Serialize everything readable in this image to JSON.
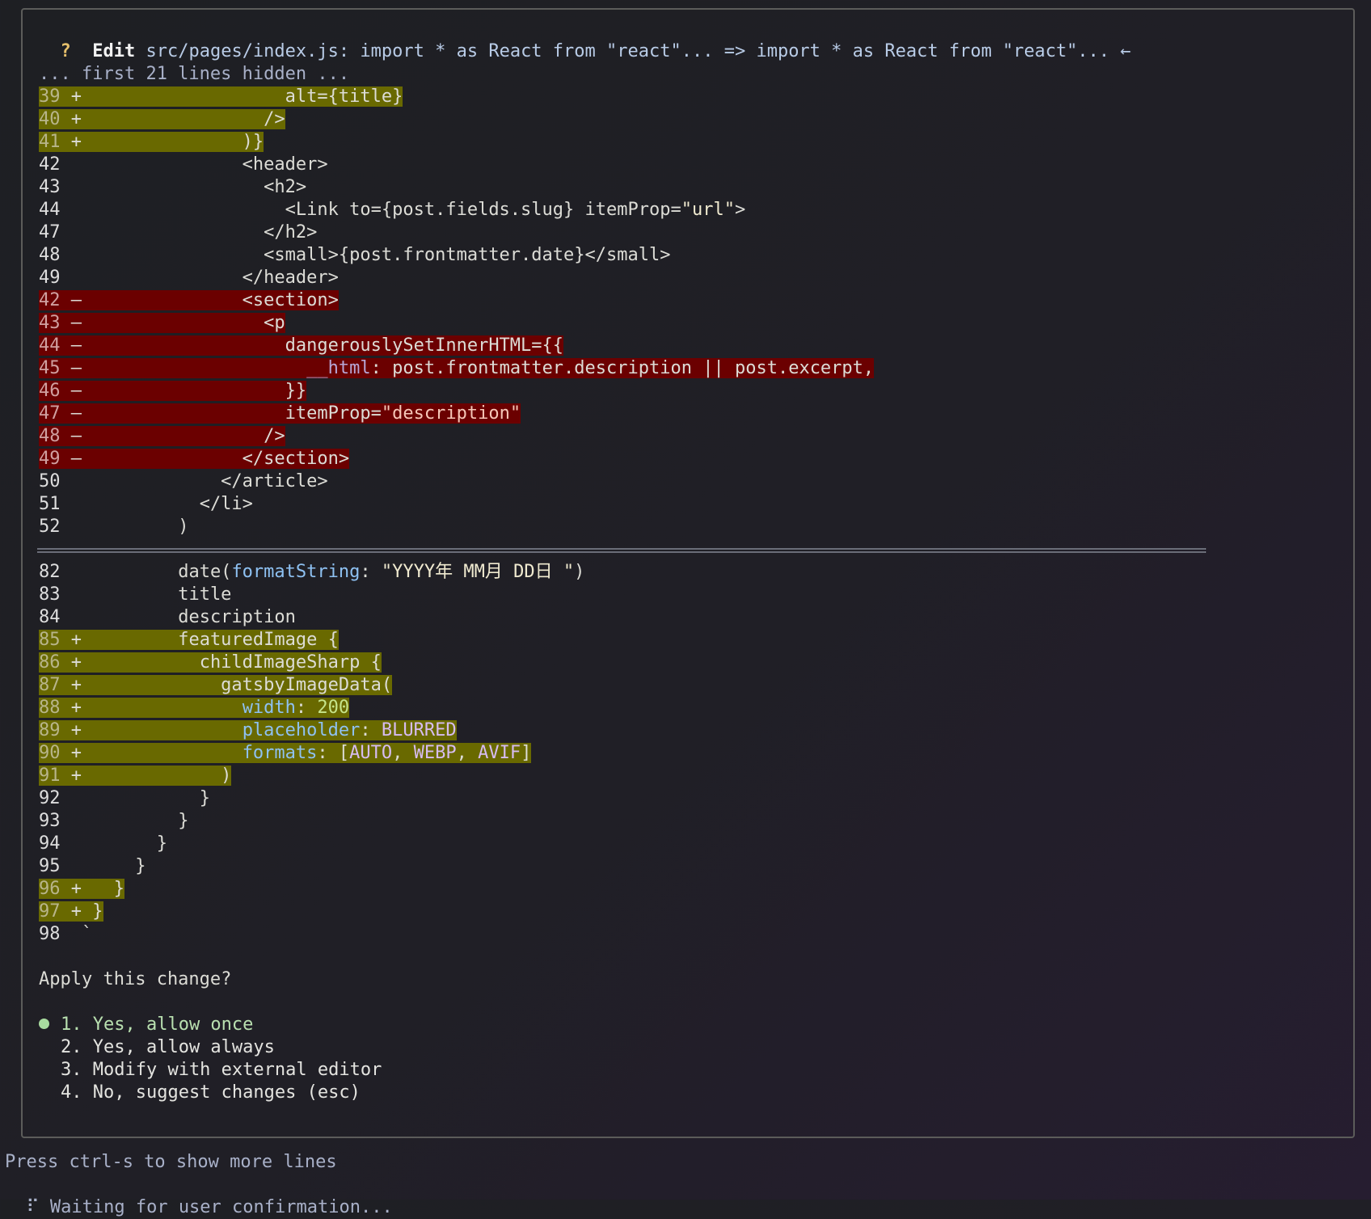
{
  "header": {
    "prompt_mark": "?",
    "action": "Edit",
    "description": "src/pages/index.js: import * as React from \"react\"... => import * as React from \"react\"... ←"
  },
  "hidden_notice": "... first 21 lines hidden ...",
  "hunk1": [
    {
      "num": "39",
      "sign": "+",
      "type": "add",
      "code": "                   alt={title}"
    },
    {
      "num": "40",
      "sign": "+",
      "type": "add",
      "code": "                 />"
    },
    {
      "num": "41",
      "sign": "+",
      "type": "add",
      "code": "               )}"
    },
    {
      "num": "42",
      "sign": " ",
      "type": "ctx",
      "code": "               <header>"
    },
    {
      "num": "43",
      "sign": " ",
      "type": "ctx",
      "code": "                 <h2>"
    },
    {
      "num": "44",
      "sign": " ",
      "type": "ctx",
      "code": "                   <Link to={post.fields.slug} itemProp=\"url\">"
    },
    {
      "num": "47",
      "sign": " ",
      "type": "ctx",
      "code": "                 </h2>"
    },
    {
      "num": "48",
      "sign": " ",
      "type": "ctx",
      "code": "                 <small>{post.frontmatter.date}</small>"
    },
    {
      "num": "49",
      "sign": " ",
      "type": "ctx",
      "code": "               </header>"
    },
    {
      "num": "42",
      "sign": "–",
      "type": "del",
      "code": "               <section>"
    },
    {
      "num": "43",
      "sign": "–",
      "type": "del",
      "code": "                 <p"
    },
    {
      "num": "44",
      "sign": "–",
      "type": "del",
      "code": "                   dangerouslySetInnerHTML={{"
    },
    {
      "num": "45",
      "sign": "–",
      "type": "del",
      "code": "                     __html: post.frontmatter.description || post.excerpt,"
    },
    {
      "num": "46",
      "sign": "–",
      "type": "del",
      "code": "                   }}"
    },
    {
      "num": "47",
      "sign": "–",
      "type": "del",
      "code": "                   itemProp=\"description\""
    },
    {
      "num": "48",
      "sign": "–",
      "type": "del",
      "code": "                 />"
    },
    {
      "num": "49",
      "sign": "–",
      "type": "del",
      "code": "               </section>"
    },
    {
      "num": "50",
      "sign": " ",
      "type": "ctx",
      "code": "             </article>"
    },
    {
      "num": "51",
      "sign": " ",
      "type": "ctx",
      "code": "           </li>"
    },
    {
      "num": "52",
      "sign": " ",
      "type": "ctx",
      "code": "         )"
    }
  ],
  "hunk2": [
    {
      "num": "82",
      "sign": " ",
      "type": "ctx",
      "code": "         date(formatString: \"YYYY年 MM月 DD日 \")"
    },
    {
      "num": "83",
      "sign": " ",
      "type": "ctx",
      "code": "         title"
    },
    {
      "num": "84",
      "sign": " ",
      "type": "ctx",
      "code": "         description"
    },
    {
      "num": "85",
      "sign": "+",
      "type": "add",
      "code": "         featuredImage {"
    },
    {
      "num": "86",
      "sign": "+",
      "type": "add",
      "code": "           childImageSharp {"
    },
    {
      "num": "87",
      "sign": "+",
      "type": "add",
      "code": "             gatsbyImageData("
    },
    {
      "num": "88",
      "sign": "+",
      "type": "add",
      "code": "               width: 200"
    },
    {
      "num": "89",
      "sign": "+",
      "type": "add",
      "code": "               placeholder: BLURRED"
    },
    {
      "num": "90",
      "sign": "+",
      "type": "add",
      "code": "               formats: [AUTO, WEBP, AVIF]"
    },
    {
      "num": "91",
      "sign": "+",
      "type": "add",
      "code": "             )"
    },
    {
      "num": "92",
      "sign": " ",
      "type": "ctx",
      "code": "           }"
    },
    {
      "num": "93",
      "sign": " ",
      "type": "ctx",
      "code": "         }"
    },
    {
      "num": "94",
      "sign": " ",
      "type": "ctx",
      "code": "       }"
    },
    {
      "num": "95",
      "sign": " ",
      "type": "ctx",
      "code": "     }"
    },
    {
      "num": "96",
      "sign": "+",
      "type": "add",
      "code": "   }"
    },
    {
      "num": "97",
      "sign": "+",
      "type": "add",
      "code": " }"
    },
    {
      "num": "98",
      "sign": " ",
      "type": "ctx",
      "code": "`"
    }
  ],
  "question": "Apply this change?",
  "options": [
    {
      "label": "1. Yes, allow once",
      "selected": true
    },
    {
      "label": "2. Yes, allow always",
      "selected": false
    },
    {
      "label": "3. Modify with external editor",
      "selected": false
    },
    {
      "label": "4. No, suggest changes (esc)",
      "selected": false
    }
  ],
  "footer": {
    "hint": "Press ctrl-s to show more lines",
    "spinner": "⠏",
    "status": "Waiting for user confirmation..."
  },
  "colors": {
    "added_background": "#696900",
    "removed_background": "#6b0000",
    "selected_option": "#b9e0b0",
    "prompt_mark": "#e6c06c"
  }
}
